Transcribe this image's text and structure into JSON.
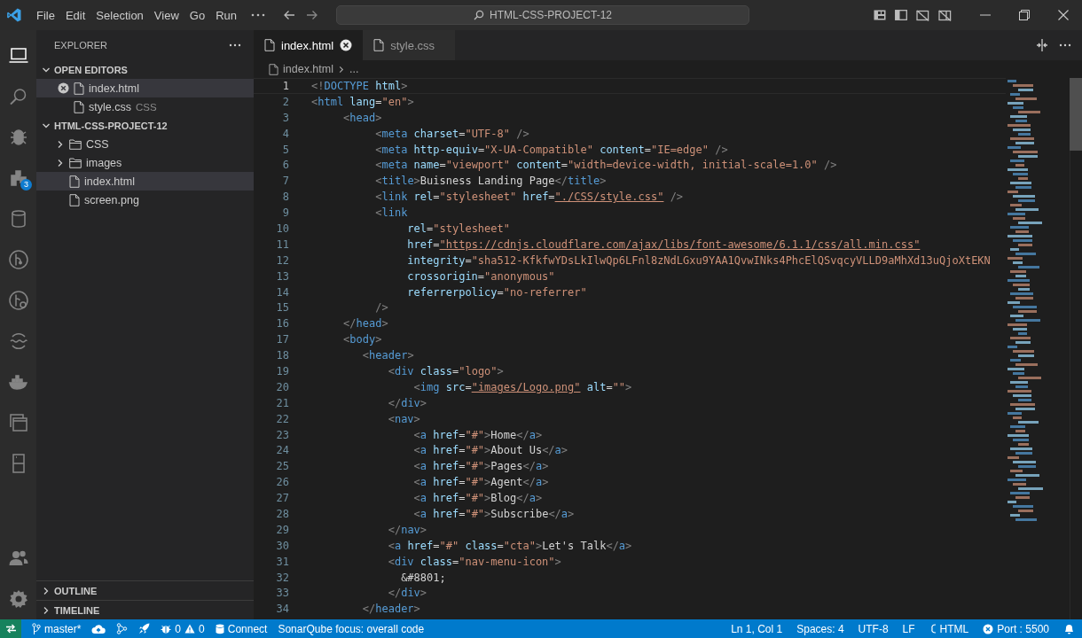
{
  "title_bar": {
    "menu": [
      "File",
      "Edit",
      "Selection",
      "View",
      "Go",
      "Run"
    ],
    "search": "HTML-CSS-PROJECT-12"
  },
  "activity_bar": [
    {
      "selected": true
    },
    {
      "selected": false
    },
    {
      "selected": false
    },
    {
      "selected": false,
      "badge": "3"
    },
    {
      "selected": false
    },
    {
      "selected": false
    },
    {
      "selected": false
    },
    {
      "selected": false
    },
    {
      "selected": false
    },
    {
      "selected": false
    },
    {
      "selected": false
    }
  ],
  "explorer": {
    "title": "EXPLORER",
    "sections": [
      {
        "title": "OPEN EDITORS",
        "expanded": true,
        "items": [
          {
            "name": "index.html",
            "kind": "file",
            "selected": true,
            "closable": true
          },
          {
            "name": "style.css",
            "description": "CSS",
            "kind": "file",
            "selected": false,
            "closable": false
          }
        ]
      },
      {
        "title": "HTML-CSS-PROJECT-12",
        "expanded": true,
        "items": [
          {
            "name": "CSS",
            "kind": "folder",
            "expanded": false,
            "selected": false
          },
          {
            "name": "images",
            "kind": "folder",
            "expanded": false,
            "selected": false
          },
          {
            "name": "index.html",
            "kind": "file",
            "selected": true
          },
          {
            "name": "screen.png",
            "kind": "file",
            "selected": false
          }
        ]
      }
    ],
    "bottom_sections": [
      {
        "title": "OUTLINE",
        "expanded": false
      },
      {
        "title": "TIMELINE",
        "expanded": false
      }
    ]
  },
  "tabs": [
    {
      "label": "index.html",
      "selected": true
    },
    {
      "label": "style.css",
      "selected": false
    }
  ],
  "breadcrumbs": [
    "index.html",
    "..."
  ],
  "editor": {
    "lines": [
      {
        "number": "1",
        "tokens": [
          {
            "kind": "punct",
            "text": "<!"
          },
          {
            "kind": "tag",
            "text": "DOCTYPE"
          },
          {
            "kind": "attr",
            "text": " html"
          },
          {
            "kind": "punct",
            "text": ">"
          }
        ]
      },
      {
        "number": "2",
        "tokens": [
          {
            "kind": "punct",
            "text": "<"
          },
          {
            "kind": "tag",
            "text": "html"
          },
          {
            "kind": "attr",
            "text": " lang"
          },
          {
            "kind": "plain",
            "text": "="
          },
          {
            "kind": "string",
            "text": "\"en\""
          },
          {
            "kind": "punct",
            "text": ">"
          }
        ]
      },
      {
        "number": "3",
        "tokens": [
          {
            "kind": "punct",
            "text": "     <"
          },
          {
            "kind": "tag",
            "text": "head"
          },
          {
            "kind": "punct",
            "text": ">"
          }
        ]
      },
      {
        "number": "4",
        "tokens": [
          {
            "kind": "punct",
            "text": "          <"
          },
          {
            "kind": "tag",
            "text": "meta"
          },
          {
            "kind": "attr",
            "text": " charset"
          },
          {
            "kind": "plain",
            "text": "="
          },
          {
            "kind": "string",
            "text": "\"UTF-8\""
          },
          {
            "kind": "punct",
            "text": " />"
          }
        ]
      },
      {
        "number": "5",
        "tokens": [
          {
            "kind": "punct",
            "text": "          <"
          },
          {
            "kind": "tag",
            "text": "meta"
          },
          {
            "kind": "attr",
            "text": " http-equiv"
          },
          {
            "kind": "plain",
            "text": "="
          },
          {
            "kind": "string",
            "text": "\"X-UA-Compatible\""
          },
          {
            "kind": "attr",
            "text": " content"
          },
          {
            "kind": "plain",
            "text": "="
          },
          {
            "kind": "string",
            "text": "\"IE=edge\""
          },
          {
            "kind": "punct",
            "text": " />"
          }
        ]
      },
      {
        "number": "6",
        "tokens": [
          {
            "kind": "punct",
            "text": "          <"
          },
          {
            "kind": "tag",
            "text": "meta"
          },
          {
            "kind": "attr",
            "text": " name"
          },
          {
            "kind": "plain",
            "text": "="
          },
          {
            "kind": "string",
            "text": "\"viewport\""
          },
          {
            "kind": "attr",
            "text": " content"
          },
          {
            "kind": "plain",
            "text": "="
          },
          {
            "kind": "string",
            "text": "\"width=device-width, initial-scale=1.0\""
          },
          {
            "kind": "punct",
            "text": " />"
          }
        ]
      },
      {
        "number": "7",
        "tokens": [
          {
            "kind": "punct",
            "text": "          <"
          },
          {
            "kind": "tag",
            "text": "title"
          },
          {
            "kind": "punct",
            "text": ">"
          },
          {
            "kind": "plain",
            "text": "Buisness Landing Page"
          },
          {
            "kind": "punct",
            "text": "</"
          },
          {
            "kind": "tag",
            "text": "title"
          },
          {
            "kind": "punct",
            "text": ">"
          }
        ]
      },
      {
        "number": "8",
        "tokens": [
          {
            "kind": "punct",
            "text": "          <"
          },
          {
            "kind": "tag",
            "text": "link"
          },
          {
            "kind": "attr",
            "text": " rel"
          },
          {
            "kind": "plain",
            "text": "="
          },
          {
            "kind": "string",
            "text": "\"stylesheet\""
          },
          {
            "kind": "attr",
            "text": " href"
          },
          {
            "kind": "plain",
            "text": "="
          },
          {
            "kind": "link",
            "text": "\"./CSS/style.css\""
          },
          {
            "kind": "punct",
            "text": " />"
          }
        ]
      },
      {
        "number": "9",
        "tokens": [
          {
            "kind": "punct",
            "text": "          <"
          },
          {
            "kind": "tag",
            "text": "link"
          }
        ]
      },
      {
        "number": "10",
        "tokens": [
          {
            "kind": "attr",
            "text": "               rel"
          },
          {
            "kind": "plain",
            "text": "="
          },
          {
            "kind": "string",
            "text": "\"stylesheet\""
          }
        ]
      },
      {
        "number": "11",
        "tokens": [
          {
            "kind": "attr",
            "text": "               href"
          },
          {
            "kind": "plain",
            "text": "="
          },
          {
            "kind": "link",
            "text": "\"https://cdnjs.cloudflare.com/ajax/libs/font-awesome/6.1.1/css/all.min.css\""
          }
        ]
      },
      {
        "number": "12",
        "tokens": [
          {
            "kind": "attr",
            "text": "               integrity"
          },
          {
            "kind": "plain",
            "text": "="
          },
          {
            "kind": "string",
            "text": "\"sha512-KfkfwYDsLkIlwQp6LFnl8zNdLGxu9YAA1QvwINks4PhcElQSvqcyVLLD9aMhXd13uQjoXtEKN"
          }
        ]
      },
      {
        "number": "13",
        "tokens": [
          {
            "kind": "attr",
            "text": "               crossorigin"
          },
          {
            "kind": "plain",
            "text": "="
          },
          {
            "kind": "string",
            "text": "\"anonymous\""
          }
        ]
      },
      {
        "number": "14",
        "tokens": [
          {
            "kind": "attr",
            "text": "               referrerpolicy"
          },
          {
            "kind": "plain",
            "text": "="
          },
          {
            "kind": "string",
            "text": "\"no-referrer\""
          }
        ]
      },
      {
        "number": "15",
        "tokens": [
          {
            "kind": "punct",
            "text": "          />"
          }
        ]
      },
      {
        "number": "16",
        "tokens": [
          {
            "kind": "punct",
            "text": "     </"
          },
          {
            "kind": "tag",
            "text": "head"
          },
          {
            "kind": "punct",
            "text": ">"
          }
        ]
      },
      {
        "number": "17",
        "tokens": [
          {
            "kind": "punct",
            "text": "     <"
          },
          {
            "kind": "tag",
            "text": "body"
          },
          {
            "kind": "punct",
            "text": ">"
          }
        ]
      },
      {
        "number": "18",
        "tokens": [
          {
            "kind": "punct",
            "text": "        <"
          },
          {
            "kind": "tag",
            "text": "header"
          },
          {
            "kind": "punct",
            "text": ">"
          }
        ]
      },
      {
        "number": "19",
        "tokens": [
          {
            "kind": "punct",
            "text": "            <"
          },
          {
            "kind": "tag",
            "text": "div"
          },
          {
            "kind": "attr",
            "text": " class"
          },
          {
            "kind": "plain",
            "text": "="
          },
          {
            "kind": "string",
            "text": "\"logo\""
          },
          {
            "kind": "punct",
            "text": ">"
          }
        ]
      },
      {
        "number": "20",
        "tokens": [
          {
            "kind": "punct",
            "text": "                <"
          },
          {
            "kind": "tag",
            "text": "img"
          },
          {
            "kind": "attr",
            "text": " src"
          },
          {
            "kind": "plain",
            "text": "="
          },
          {
            "kind": "link",
            "text": "\"images/Logo.png\""
          },
          {
            "kind": "attr",
            "text": " alt"
          },
          {
            "kind": "plain",
            "text": "="
          },
          {
            "kind": "string",
            "text": "\"\""
          },
          {
            "kind": "punct",
            "text": ">"
          }
        ]
      },
      {
        "number": "21",
        "tokens": [
          {
            "kind": "punct",
            "text": "            </"
          },
          {
            "kind": "tag",
            "text": "div"
          },
          {
            "kind": "punct",
            "text": ">"
          }
        ]
      },
      {
        "number": "22",
        "tokens": [
          {
            "kind": "punct",
            "text": "            <"
          },
          {
            "kind": "tag",
            "text": "nav"
          },
          {
            "kind": "punct",
            "text": ">"
          }
        ]
      },
      {
        "number": "23",
        "tokens": [
          {
            "kind": "punct",
            "text": "                <"
          },
          {
            "kind": "tag",
            "text": "a"
          },
          {
            "kind": "attr",
            "text": " href"
          },
          {
            "kind": "plain",
            "text": "="
          },
          {
            "kind": "string",
            "text": "\"#\""
          },
          {
            "kind": "punct",
            "text": ">"
          },
          {
            "kind": "plain",
            "text": "Home"
          },
          {
            "kind": "punct",
            "text": "</"
          },
          {
            "kind": "tag",
            "text": "a"
          },
          {
            "kind": "punct",
            "text": ">"
          }
        ]
      },
      {
        "number": "24",
        "tokens": [
          {
            "kind": "punct",
            "text": "                <"
          },
          {
            "kind": "tag",
            "text": "a"
          },
          {
            "kind": "attr",
            "text": " href"
          },
          {
            "kind": "plain",
            "text": "="
          },
          {
            "kind": "string",
            "text": "\"#\""
          },
          {
            "kind": "punct",
            "text": ">"
          },
          {
            "kind": "plain",
            "text": "About Us"
          },
          {
            "kind": "punct",
            "text": "</"
          },
          {
            "kind": "tag",
            "text": "a"
          },
          {
            "kind": "punct",
            "text": ">"
          }
        ]
      },
      {
        "number": "25",
        "tokens": [
          {
            "kind": "punct",
            "text": "                <"
          },
          {
            "kind": "tag",
            "text": "a"
          },
          {
            "kind": "attr",
            "text": " href"
          },
          {
            "kind": "plain",
            "text": "="
          },
          {
            "kind": "string",
            "text": "\"#\""
          },
          {
            "kind": "punct",
            "text": ">"
          },
          {
            "kind": "plain",
            "text": "Pages"
          },
          {
            "kind": "punct",
            "text": "</"
          },
          {
            "kind": "tag",
            "text": "a"
          },
          {
            "kind": "punct",
            "text": ">"
          }
        ]
      },
      {
        "number": "26",
        "tokens": [
          {
            "kind": "punct",
            "text": "                <"
          },
          {
            "kind": "tag",
            "text": "a"
          },
          {
            "kind": "attr",
            "text": " href"
          },
          {
            "kind": "plain",
            "text": "="
          },
          {
            "kind": "string",
            "text": "\"#\""
          },
          {
            "kind": "punct",
            "text": ">"
          },
          {
            "kind": "plain",
            "text": "Agent"
          },
          {
            "kind": "punct",
            "text": "</"
          },
          {
            "kind": "tag",
            "text": "a"
          },
          {
            "kind": "punct",
            "text": ">"
          }
        ]
      },
      {
        "number": "27",
        "tokens": [
          {
            "kind": "punct",
            "text": "                <"
          },
          {
            "kind": "tag",
            "text": "a"
          },
          {
            "kind": "attr",
            "text": " href"
          },
          {
            "kind": "plain",
            "text": "="
          },
          {
            "kind": "string",
            "text": "\"#\""
          },
          {
            "kind": "punct",
            "text": ">"
          },
          {
            "kind": "plain",
            "text": "Blog"
          },
          {
            "kind": "punct",
            "text": "</"
          },
          {
            "kind": "tag",
            "text": "a"
          },
          {
            "kind": "punct",
            "text": ">"
          }
        ]
      },
      {
        "number": "28",
        "tokens": [
          {
            "kind": "punct",
            "text": "                <"
          },
          {
            "kind": "tag",
            "text": "a"
          },
          {
            "kind": "attr",
            "text": " href"
          },
          {
            "kind": "plain",
            "text": "="
          },
          {
            "kind": "string",
            "text": "\"#\""
          },
          {
            "kind": "punct",
            "text": ">"
          },
          {
            "kind": "plain",
            "text": "Subscribe"
          },
          {
            "kind": "punct",
            "text": "</"
          },
          {
            "kind": "tag",
            "text": "a"
          },
          {
            "kind": "punct",
            "text": ">"
          }
        ]
      },
      {
        "number": "29",
        "tokens": [
          {
            "kind": "punct",
            "text": "            </"
          },
          {
            "kind": "tag",
            "text": "nav"
          },
          {
            "kind": "punct",
            "text": ">"
          }
        ]
      },
      {
        "number": "30",
        "tokens": [
          {
            "kind": "punct",
            "text": "            <"
          },
          {
            "kind": "tag",
            "text": "a"
          },
          {
            "kind": "attr",
            "text": " href"
          },
          {
            "kind": "plain",
            "text": "="
          },
          {
            "kind": "string",
            "text": "\"#\""
          },
          {
            "kind": "attr",
            "text": " class"
          },
          {
            "kind": "plain",
            "text": "="
          },
          {
            "kind": "string",
            "text": "\"cta\""
          },
          {
            "kind": "punct",
            "text": ">"
          },
          {
            "kind": "plain",
            "text": "Let's Talk"
          },
          {
            "kind": "punct",
            "text": "</"
          },
          {
            "kind": "tag",
            "text": "a"
          },
          {
            "kind": "punct",
            "text": ">"
          }
        ]
      },
      {
        "number": "31",
        "tokens": [
          {
            "kind": "punct",
            "text": "            <"
          },
          {
            "kind": "tag",
            "text": "div"
          },
          {
            "kind": "attr",
            "text": " class"
          },
          {
            "kind": "plain",
            "text": "="
          },
          {
            "kind": "string",
            "text": "\"nav-menu-icon\""
          },
          {
            "kind": "punct",
            "text": ">"
          }
        ]
      },
      {
        "number": "32",
        "tokens": [
          {
            "kind": "plain",
            "text": "              &#8801;"
          }
        ]
      },
      {
        "number": "33",
        "tokens": [
          {
            "kind": "punct",
            "text": "            </"
          },
          {
            "kind": "tag",
            "text": "div"
          },
          {
            "kind": "punct",
            "text": ">"
          }
        ]
      },
      {
        "number": "34",
        "tokens": [
          {
            "kind": "punct",
            "text": "        </"
          },
          {
            "kind": "tag",
            "text": "header"
          },
          {
            "kind": "punct",
            "text": ">"
          }
        ]
      }
    ]
  },
  "status_bar": {
    "left": [
      {
        "kind": "branch",
        "text": "master*"
      },
      {
        "kind": "sync"
      },
      {
        "kind": "graph"
      },
      {
        "kind": "deploy"
      },
      {
        "kind": "problems",
        "errors": "0",
        "warnings": "0"
      },
      {
        "kind": "connect",
        "text": "Connect"
      },
      {
        "kind": "plain",
        "text": "SonarQube focus: overall code"
      }
    ],
    "right": [
      {
        "kind": "plain",
        "text": "Ln 1, Col 1"
      },
      {
        "kind": "plain",
        "text": "Spaces: 4"
      },
      {
        "kind": "plain",
        "text": "UTF-8"
      },
      {
        "kind": "plain",
        "text": "LF"
      },
      {
        "kind": "language",
        "text": "HTML"
      },
      {
        "kind": "port",
        "text": "Port : 5500"
      },
      {
        "kind": "notifications"
      }
    ]
  }
}
